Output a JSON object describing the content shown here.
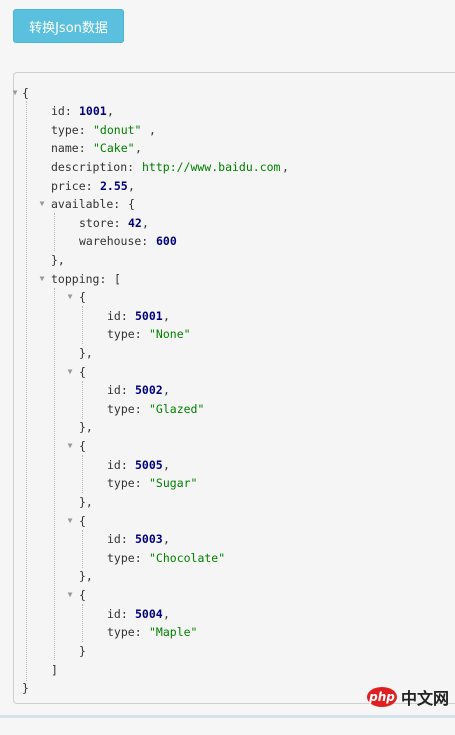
{
  "toolbar": {
    "convert_label": "转换Json数据"
  },
  "watermark": {
    "brand": "php",
    "suffix": "中文网"
  },
  "json": {
    "open_brace": "{",
    "id_key": "id:",
    "id_val": "1001",
    "id_comma": ",",
    "type_key": "type:",
    "type_val": "\"donut\"",
    "type_comma": ",",
    "name_key": "name:",
    "name_val": "\"Cake\"",
    "name_comma": ",",
    "desc_key": "description:",
    "desc_val": "http://www.baidu.com",
    "desc_comma": ",",
    "price_key": "price:",
    "price_val": "2.55",
    "price_comma": ",",
    "available_key": "available:",
    "available_open": "{",
    "store_key": "store:",
    "store_val": "42",
    "store_comma": ",",
    "warehouse_key": "warehouse:",
    "warehouse_val": "600",
    "available_close": "},",
    "topping_key": "topping:",
    "topping_open": "[",
    "toppings": [
      {
        "open": "{",
        "id_key": "id:",
        "id": "5001",
        "c1": ",",
        "type_key": "type:",
        "type": "\"None\"",
        "close": "},"
      },
      {
        "open": "{",
        "id_key": "id:",
        "id": "5002",
        "c1": ",",
        "type_key": "type:",
        "type": "\"Glazed\"",
        "close": "},"
      },
      {
        "open": "{",
        "id_key": "id:",
        "id": "5005",
        "c1": ",",
        "type_key": "type:",
        "type": "\"Sugar\"",
        "close": "},"
      },
      {
        "open": "{",
        "id_key": "id:",
        "id": "5003",
        "c1": ",",
        "type_key": "type:",
        "type": "\"Chocolate\"",
        "close": "},"
      },
      {
        "open": "{",
        "id_key": "id:",
        "id": "5004",
        "c1": ",",
        "type_key": "type:",
        "type": "\"Maple\"",
        "close": "}"
      }
    ],
    "topping_close": "]",
    "close_brace": "}"
  },
  "colors": {
    "button_bg": "#5bc0de",
    "number": "#000080",
    "string": "#008000",
    "toggle": "#999999"
  },
  "icons": {
    "collapse": "triangle-down-icon"
  }
}
